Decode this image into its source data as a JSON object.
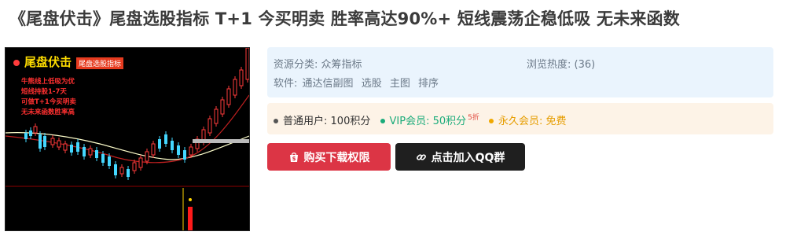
{
  "page": {
    "title": "《尾盘伏击》尾盘选股指标 T+1 今买明卖 胜率高达90%+ 短线震荡企稳低吸 无未来函数"
  },
  "thumbnail": {
    "headline": "尾盘伏击",
    "tag": "尾盘选股指标",
    "lines": [
      "牛熊线上低吸为优",
      "短线持股1-7天",
      "可做T+1今买明卖",
      "无未来函数胜率高"
    ]
  },
  "info": {
    "category_label": "资源分类:",
    "category_value": "众筹指标",
    "views_label": "浏览热度:",
    "views_value": "(36)",
    "software_label": "软件:",
    "software_tags": [
      "通达信副图",
      "选股",
      "主图",
      "排序"
    ]
  },
  "pricing": {
    "normal_label": "普通用户:",
    "normal_value": "100积分",
    "vip_label": "VIP会员:",
    "vip_value": "50积分",
    "vip_discount": "5折",
    "forever_label": "永久会员:",
    "forever_value": "免费"
  },
  "buttons": {
    "buy_label": "购买下载权限",
    "qq_label": "点击加入QQ群"
  },
  "colors": {
    "buy": "#dc3545",
    "qq": "#1f1f1f",
    "vip": "#1aab7a",
    "forever": "#e69d00"
  }
}
